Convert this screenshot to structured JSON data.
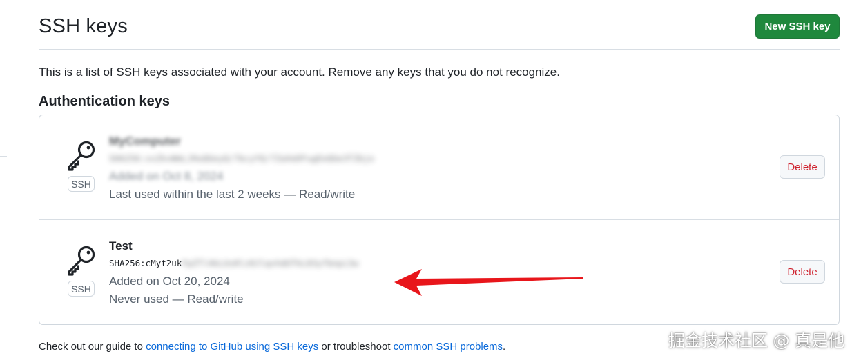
{
  "header": {
    "title": "SSH keys",
    "new_button_label": "New SSH key"
  },
  "intro_text": "This is a list of SSH keys associated with your account. Remove any keys that you do not recognize.",
  "section_title": "Authentication keys",
  "keys": [
    {
      "title": "MyComputer",
      "fingerprint": "SHA256:xxZkvWmLJHuQGeyQ/7bcyYQ/7ZaXeDFugEeQGe3TZbjo",
      "added": "Added on Oct 8, 2024",
      "usage": "Last used within the last 2 weeks — Read/write",
      "badge": "SSH",
      "delete_label": "Delete"
    },
    {
      "title": "Test",
      "fingerprint_visible": "SHA256:cMyt2uk",
      "fingerprint_hidden": "FpZTl4kLUs0lz0JlqvhdUTkL03yfbnpi3w",
      "added": "Added on Oct 20, 2024",
      "usage": "Never used — Read/write",
      "badge": "SSH",
      "delete_label": "Delete"
    }
  ],
  "footer": {
    "prefix": "Check out our guide to ",
    "link1": "connecting to GitHub using SSH keys",
    "middle": " or troubleshoot ",
    "link2": "common SSH problems",
    "suffix": "."
  },
  "watermark": "掘金技术社区 @ 真是他",
  "colors": {
    "primary_button": "#1f883d",
    "danger_text": "#cf222e",
    "link": "#0969da",
    "annotation_arrow": "#e8161b",
    "border": "#d0d7de"
  },
  "icons": {
    "key": "key-icon",
    "annotation": "red-arrow-annotation"
  }
}
